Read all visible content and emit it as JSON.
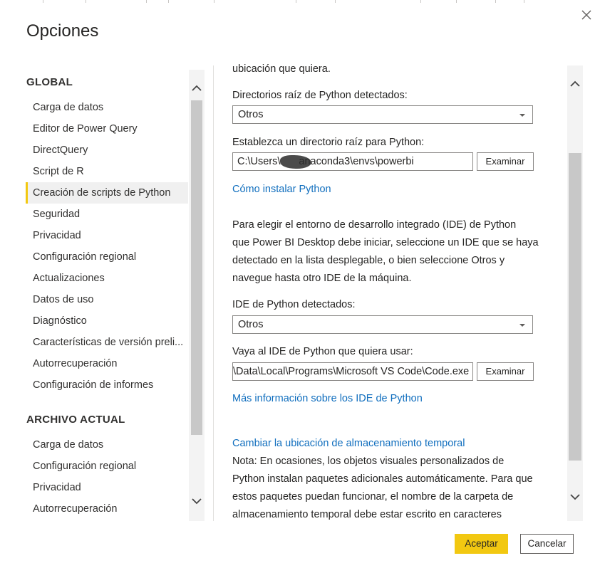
{
  "dialog": {
    "title": "Opciones",
    "close_icon": "close-icon"
  },
  "sidebar": {
    "global_header": "GLOBAL",
    "global_items": [
      {
        "label": "Carga de datos"
      },
      {
        "label": "Editor de Power Query"
      },
      {
        "label": "DirectQuery"
      },
      {
        "label": "Script de R"
      },
      {
        "label": "Creación de scripts de Python",
        "selected": true
      },
      {
        "label": "Seguridad"
      },
      {
        "label": "Privacidad"
      },
      {
        "label": "Configuración regional"
      },
      {
        "label": "Actualizaciones"
      },
      {
        "label": "Datos de uso"
      },
      {
        "label": "Diagnóstico"
      },
      {
        "label": "Características de versión preli..."
      },
      {
        "label": "Autorrecuperación"
      },
      {
        "label": "Configuración de informes"
      }
    ],
    "current_header": "ARCHIVO ACTUAL",
    "current_items": [
      {
        "label": "Carga de datos"
      },
      {
        "label": "Configuración regional"
      },
      {
        "label": "Privacidad"
      },
      {
        "label": "Autorrecuperación"
      }
    ]
  },
  "content": {
    "top_text": "ubicación que quiera.",
    "detected_roots_label": "Directorios raíz de Python detectados:",
    "detected_roots_value": "Otros",
    "root_dir_label": "Establezca un directorio raíz para Python:",
    "root_dir_prefix": "C:\\Users\\",
    "root_dir_suffix": "anaconda3\\envs\\powerbi",
    "browse_label_1": "Examinar",
    "install_link": "Cómo instalar Python",
    "ide_paragraph": [
      "Para elegir el entorno de desarrollo integrado (IDE) de Python",
      "que Power BI Desktop debe iniciar, seleccione un IDE que se haya",
      "detectado en la lista desplegable, o bien seleccione Otros y",
      "navegue hasta otro IDE de la máquina."
    ],
    "detected_ide_label": "IDE de Python detectados:",
    "detected_ide_value": "Otros",
    "ide_path_label": "Vaya al IDE de Python que quiera usar:",
    "ide_path_value": "\\Data\\Local\\Programs\\Microsoft VS Code\\Code.exe",
    "browse_label_2": "Examinar",
    "ide_info_link": "Más información sobre los IDE de Python",
    "temp_link": "Cambiar la ubicación de almacenamiento temporal",
    "note_paragraph": [
      "Nota: En ocasiones, los objetos visuales personalizados de",
      "Python instalan paquetes adicionales automáticamente. Para que",
      "estos paquetes puedan funcionar, el nombre de la carpeta de",
      "almacenamiento temporal debe estar escrito en caracteres"
    ]
  },
  "footer": {
    "ok_label": "Aceptar",
    "cancel_label": "Cancelar"
  },
  "colors": {
    "accent": "#f2c811",
    "link": "#106ebe"
  }
}
